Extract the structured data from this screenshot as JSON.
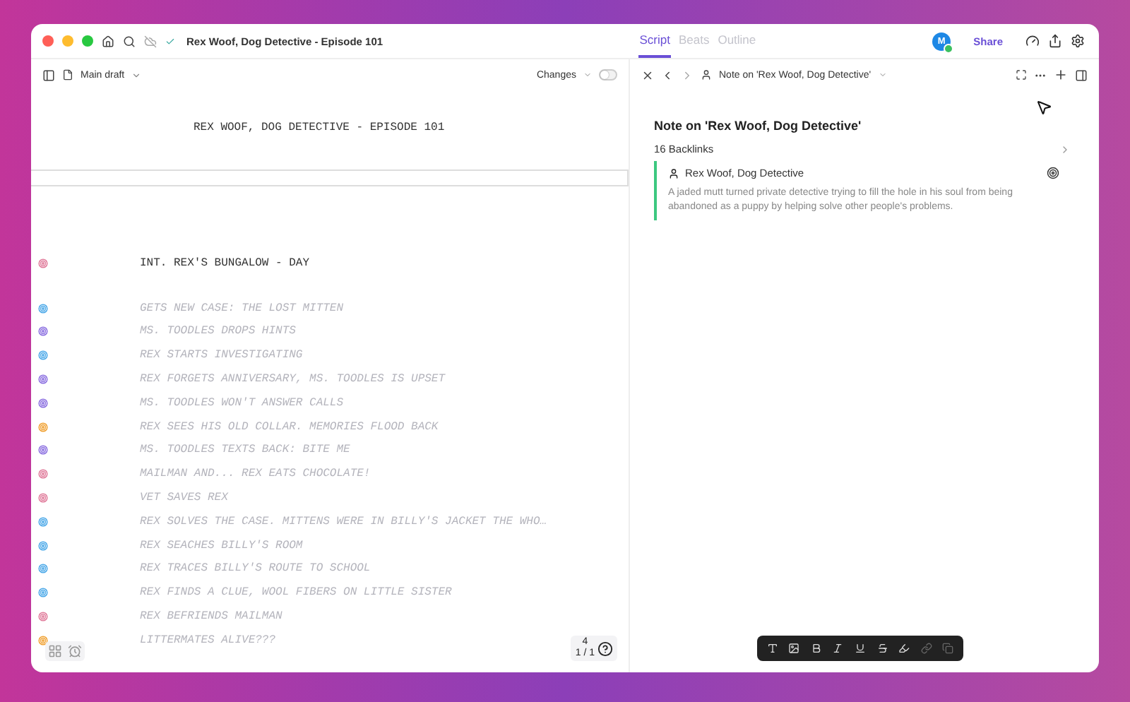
{
  "window": {
    "title": "Rex Woof, Dog Detective - Episode 101",
    "synced": true
  },
  "view_tabs": [
    {
      "label": "Script",
      "selected": true
    },
    {
      "label": "Beats",
      "selected": false
    },
    {
      "label": "Outline",
      "selected": false
    }
  ],
  "user": {
    "initial": "M",
    "online": true
  },
  "share_label": "Share",
  "script_toolbar": {
    "draft": "Main draft",
    "changes_label": "Changes",
    "changes_on": false
  },
  "script": {
    "title": "REX WOOF, DOG DETECTIVE - EPISODE 101",
    "lines": [
      {
        "kind": "scene",
        "text": "INT. REX'S BUNGALOW - DAY",
        "color": "#e07a9a"
      },
      {
        "kind": "beat",
        "text": "GETS NEW CASE: THE LOST MITTEN",
        "color": "#4aa8e8"
      },
      {
        "kind": "beat",
        "text": "MS. TOODLES DROPS HINTS",
        "color": "#8a6ee0"
      },
      {
        "kind": "beat",
        "text": "REX STARTS INVESTIGATING",
        "color": "#4aa8e8"
      },
      {
        "kind": "beat",
        "text": "REX FORGETS ANNIVERSARY, MS. TOODLES IS UPSET",
        "color": "#8a6ee0"
      },
      {
        "kind": "beat",
        "text": "MS. TOODLES WON'T ANSWER CALLS",
        "color": "#8a6ee0"
      },
      {
        "kind": "beat",
        "text": "REX SEES HIS OLD COLLAR. MEMORIES FLOOD BACK",
        "color": "#f0a030"
      },
      {
        "kind": "beat",
        "text": "MS. TOODLES TEXTS BACK: BITE ME",
        "color": "#8a6ee0"
      },
      {
        "kind": "beat",
        "text": "MAILMAN AND... REX EATS CHOCOLATE!",
        "color": "#e07a9a"
      },
      {
        "kind": "beat",
        "text": "VET SAVES REX",
        "color": "#e07a9a"
      },
      {
        "kind": "beat",
        "text": "REX SOLVES THE CASE. MITTENS WERE IN BILLY'S JACKET THE WHO…",
        "color": "#4aa8e8"
      },
      {
        "kind": "beat",
        "text": "REX SEACHES BILLY'S ROOM",
        "color": "#4aa8e8"
      },
      {
        "kind": "beat",
        "text": "REX TRACES BILLY'S ROUTE TO SCHOOL",
        "color": "#4aa8e8"
      },
      {
        "kind": "beat",
        "text": "REX FINDS A CLUE, WOOL FIBERS ON LITTLE SISTER",
        "color": "#4aa8e8"
      },
      {
        "kind": "beat",
        "text": "REX BEFRIENDS MAILMAN",
        "color": "#e07a9a"
      },
      {
        "kind": "beat",
        "text": "LITTERMATES ALIVE???",
        "color": "#f0a030"
      }
    ]
  },
  "page_counter": {
    "page": "4",
    "of": "1 / 1"
  },
  "note_panel": {
    "breadcrumb": "Note on 'Rex Woof, Dog Detective'",
    "heading": "Note on 'Rex Woof, Dog Detective'",
    "backlinks": "16 Backlinks",
    "card": {
      "name": "Rex Woof, Dog Detective",
      "description": "A jaded mutt turned private detective trying to fill the hole in his soul from being abandoned as a puppy by helping solve other people's problems."
    }
  }
}
